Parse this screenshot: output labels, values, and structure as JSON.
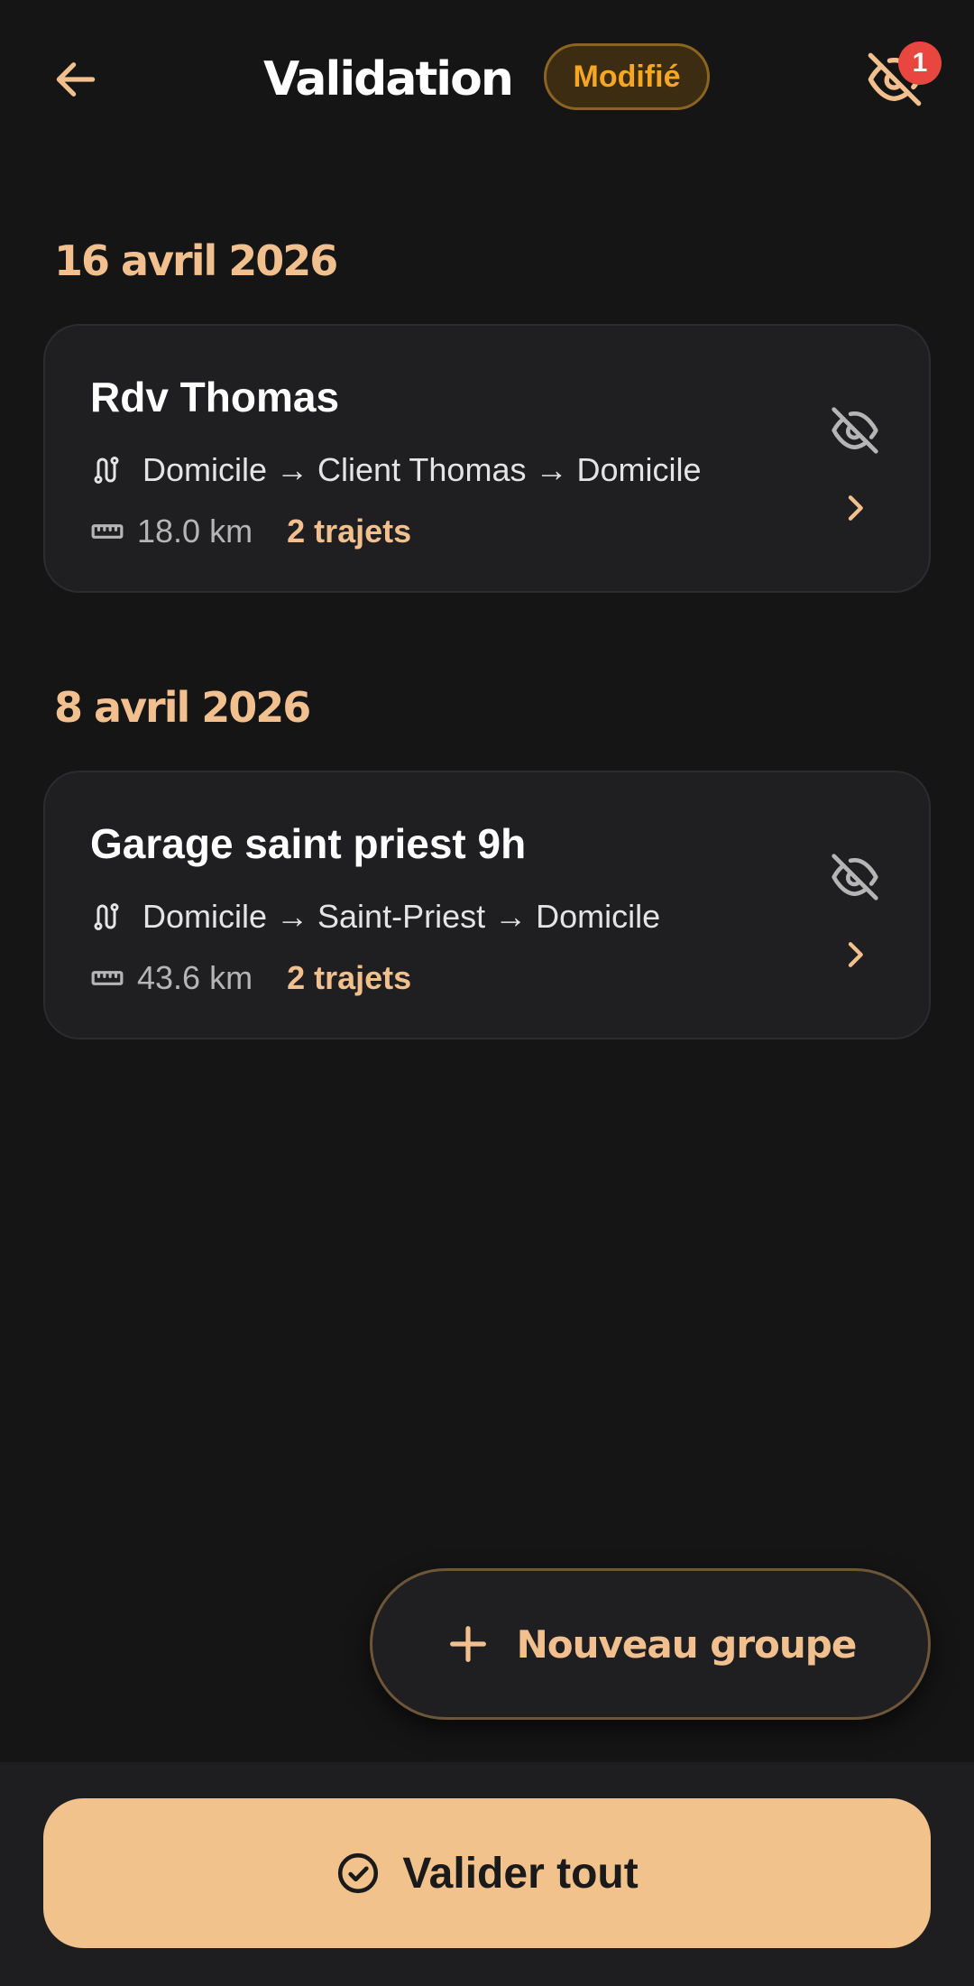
{
  "header": {
    "title": "Validation",
    "status_badge": "Modifié",
    "hidden_count": "1"
  },
  "groups": [
    {
      "date": "16 avril 2026",
      "title": "Rdv Thomas",
      "route": "Domicile → Client Thomas → Domicile",
      "distance": "18.0 km",
      "trips": "2 trajets"
    },
    {
      "date": "8 avril 2026",
      "title": "Garage saint priest 9h",
      "route": "Domicile → Saint-Priest → Domicile",
      "distance": "43.6 km",
      "trips": "2 trajets"
    }
  ],
  "fab": {
    "label": "Nouveau groupe"
  },
  "footer": {
    "validate_label": "Valider tout"
  },
  "colors": {
    "accent": "#f1c08e",
    "badge_text": "#f5a623",
    "notification": "#e9463f",
    "background": "#151515",
    "card": "#1f1f22"
  },
  "icons": [
    "back-arrow-icon",
    "eye-off-icon",
    "route-icon",
    "ruler-icon",
    "chevron-right-icon",
    "plus-icon",
    "check-circle-icon"
  ]
}
